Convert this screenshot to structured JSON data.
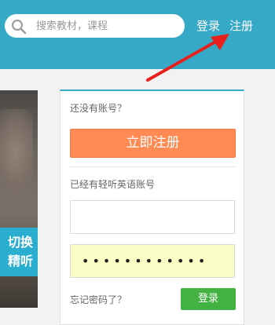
{
  "header": {
    "search": {
      "placeholder": "搜索教材，课程",
      "icon": "search-icon"
    },
    "login_label": "登录",
    "register_label": "注册",
    "background_color": "#36a9c6"
  },
  "banner": {
    "caption_line1": "切换",
    "caption_line2": "精听"
  },
  "login_panel": {
    "no_account_text": "还没有账号？",
    "register_button_label": "立即注册",
    "have_account_text": "已经有轻听英语账号",
    "username_value": "",
    "password_value": "••••••••••••",
    "forgot_password_label": "忘记密码了？",
    "login_button_label": "登录",
    "register_button_color": "#ff8a53",
    "login_button_color": "#43b243",
    "password_field_color": "#fbfdc6"
  },
  "annotation": {
    "icon": "red-arrow-icon",
    "color": "#e8201c"
  }
}
